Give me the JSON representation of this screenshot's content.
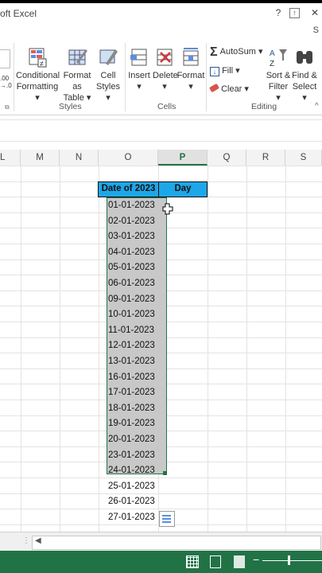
{
  "window": {
    "title": "oft Excel",
    "help": "?",
    "restore": "🗗",
    "close": "✕"
  },
  "account_initial": "S",
  "ribbon": {
    "styles_group": {
      "label": "Styles",
      "buttons": [
        {
          "line1": "Conditional",
          "line2": "Formatting ▾"
        },
        {
          "line1": "Format as",
          "line2": "Table ▾"
        },
        {
          "line1": "Cell",
          "line2": "Styles ▾"
        }
      ]
    },
    "cells_group": {
      "label": "Cells",
      "buttons": [
        {
          "line1": "Insert",
          "line2": "▾"
        },
        {
          "line1": "Delete",
          "line2": "▾"
        },
        {
          "line1": "Format",
          "line2": "▾"
        }
      ]
    },
    "editing_group": {
      "label": "Editing",
      "autosum": "AutoSum ▾",
      "fill": "Fill ▾",
      "clear": "Clear ▾",
      "sort": {
        "line1": "Sort &",
        "line2": "Filter ▾"
      },
      "find": {
        "line1": "Find &",
        "line2": "Select ▾"
      }
    },
    "number_fragment": {
      "top": ".00",
      "bottom": "→.0"
    }
  },
  "columns": [
    "L",
    "M",
    "N",
    "O",
    "P",
    "Q",
    "R",
    "S"
  ],
  "active_column": "P",
  "table": {
    "headers": [
      "Date of 2023",
      "Day"
    ],
    "dates": [
      "01-01-2023",
      "02-01-2023",
      "03-01-2023",
      "04-01-2023",
      "05-01-2023",
      "06-01-2023",
      "09-01-2023",
      "10-01-2023",
      "11-01-2023",
      "12-01-2023",
      "13-01-2023",
      "16-01-2023",
      "17-01-2023",
      "18-01-2023",
      "19-01-2023",
      "20-01-2023",
      "23-01-2023",
      "24-01-2023",
      "25-01-2023",
      "26-01-2023",
      "27-01-2023"
    ]
  },
  "colors": {
    "header_fill": "#1ea7e8",
    "status_bar": "#217346",
    "selection": "#c8c8c8"
  }
}
